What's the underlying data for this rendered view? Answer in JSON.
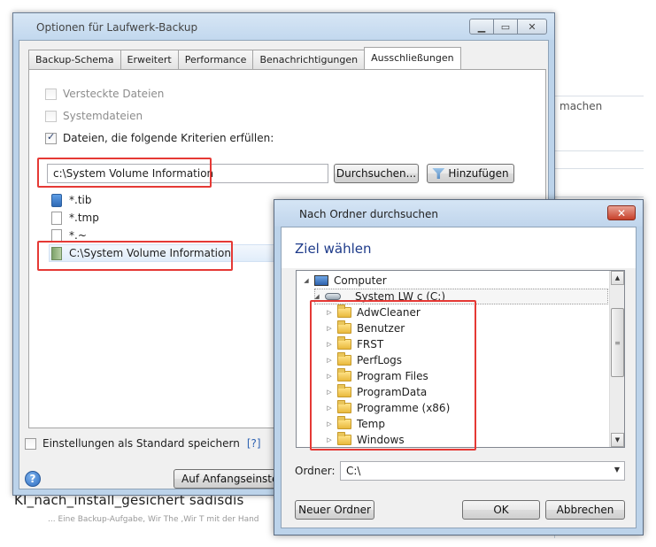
{
  "main_window": {
    "title": "Optionen für Laufwerk-Backup",
    "tabs": [
      "Backup-Schema",
      "Erweitert",
      "Performance",
      "Benachrichtigungen",
      "Ausschließungen"
    ],
    "active_tab": "Ausschließungen",
    "checkboxes": [
      {
        "label": "Versteckte Dateien",
        "checked": false,
        "enabled": false
      },
      {
        "label": "Systemdateien",
        "checked": false,
        "enabled": false
      },
      {
        "label": "Dateien, die folgende Kriterien erfüllen:",
        "checked": true,
        "enabled": true
      }
    ],
    "path_input_value": "c:\\System Volume Information",
    "browse_button": "Durchsuchen...",
    "add_button": "Hinzufügen",
    "exclusions": [
      "*.tib",
      "*.tmp",
      "*.~",
      "C:\\System Volume Information"
    ],
    "save_default_label": "Einstellungen als Standard speichern",
    "help_link": "[?]",
    "reset_button": "Auf Anfangseinstell"
  },
  "background": {
    "fragment_text": "machen",
    "strip_text": "KI_nach_install_gesichert sadisdis",
    "strip_subtext": "... Eine Backup-Aufgabe, Wir The ,Wir T mit der Hand"
  },
  "browse_dialog": {
    "title": "Nach Ordner durchsuchen",
    "heading": "Ziel wählen",
    "tree": {
      "root": "Computer",
      "drive": "System LW c (C:)",
      "folders": [
        "AdwCleaner",
        "Benutzer",
        "FRST",
        "PerfLogs",
        "Program Files",
        "ProgramData",
        "Programme (x86)",
        "Temp",
        "Windows"
      ]
    },
    "folder_label": "Ordner:",
    "folder_value": "C:\\",
    "new_folder_button": "Neuer Ordner",
    "ok_button": "OK",
    "cancel_button": "Abbrechen"
  },
  "colors": {
    "highlight_border": "#e53935",
    "heading_blue": "#1e3b8a",
    "close_red": "#c7402a"
  }
}
